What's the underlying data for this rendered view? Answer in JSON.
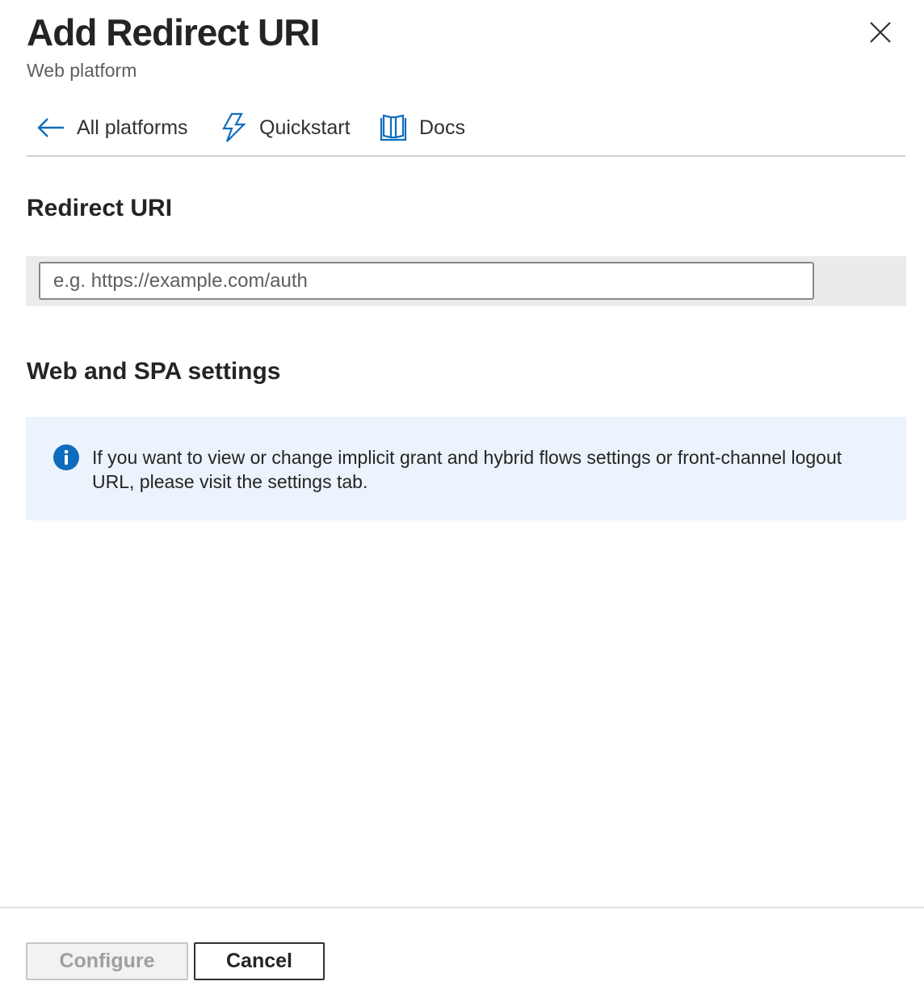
{
  "header": {
    "title": "Add Redirect URI",
    "subtitle": "Web platform",
    "close_icon": "close-icon"
  },
  "toolbar": {
    "items": [
      {
        "label": "All platforms",
        "icon": "arrow-left-icon"
      },
      {
        "label": "Quickstart",
        "icon": "lightning-icon"
      },
      {
        "label": "Docs",
        "icon": "book-icon"
      }
    ]
  },
  "redirect": {
    "heading": "Redirect URI",
    "value": "",
    "placeholder": "e.g. https://example.com/auth"
  },
  "settings": {
    "heading": "Web and SPA settings",
    "info_icon": "info-icon",
    "info_text": "If you want to view or change implicit grant and hybrid flows settings or front-channel logout URL, please visit the settings tab."
  },
  "footer": {
    "configure_label": "Configure",
    "cancel_label": "Cancel"
  },
  "colors": {
    "accent": "#0f6cbd",
    "info_background": "#ebf3fc",
    "input_row_background": "#edebe9"
  }
}
